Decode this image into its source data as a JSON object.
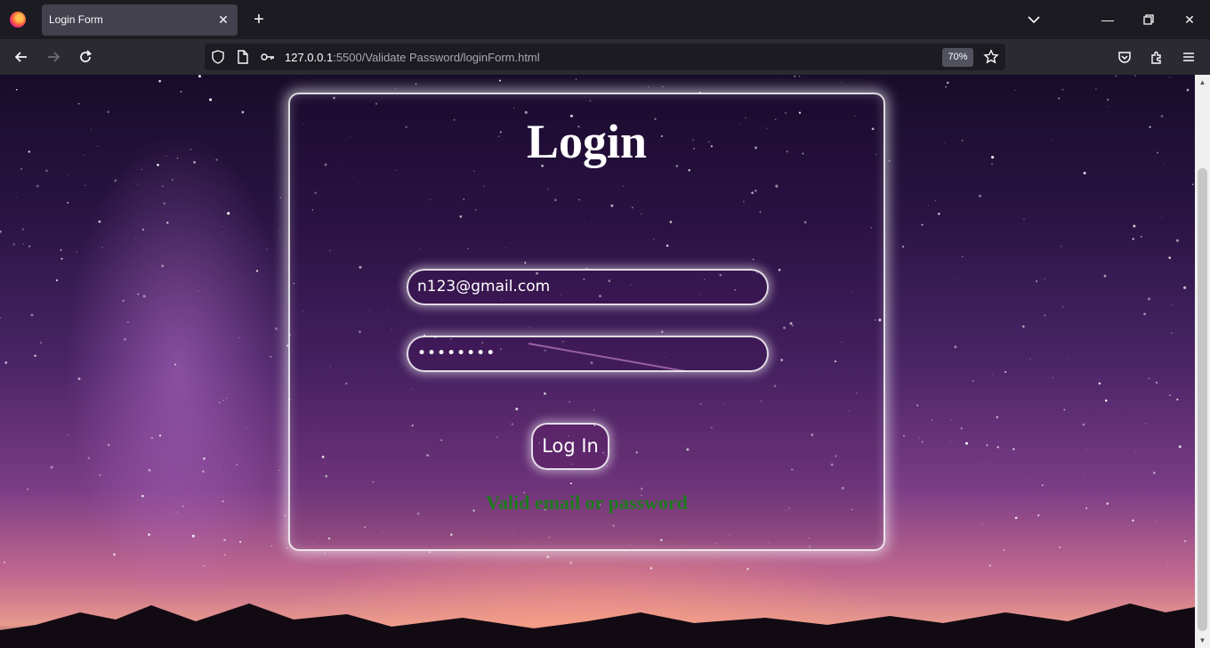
{
  "browser": {
    "tab_title": "Login Form",
    "url_host": "127.0.0.1",
    "url_rest": ":5500/Validate Password/loginForm.html",
    "zoom": "70%"
  },
  "icons": {
    "close": "close-icon",
    "new_tab": "plus-icon",
    "back": "back-arrow-icon",
    "forward": "forward-arrow-icon",
    "reload": "reload-icon",
    "shield": "shield-icon",
    "page": "page-icon",
    "key": "key-icon",
    "star": "star-icon",
    "pocket": "pocket-icon",
    "extensions": "puzzle-icon",
    "menu": "hamburger-menu-icon"
  },
  "login": {
    "title": "Login",
    "email_value": "n123@gmail.com",
    "password_mask": "••••••••",
    "button_label": "Log In",
    "message": "Valid email or password"
  },
  "colors": {
    "message": "#1d7a1d"
  }
}
